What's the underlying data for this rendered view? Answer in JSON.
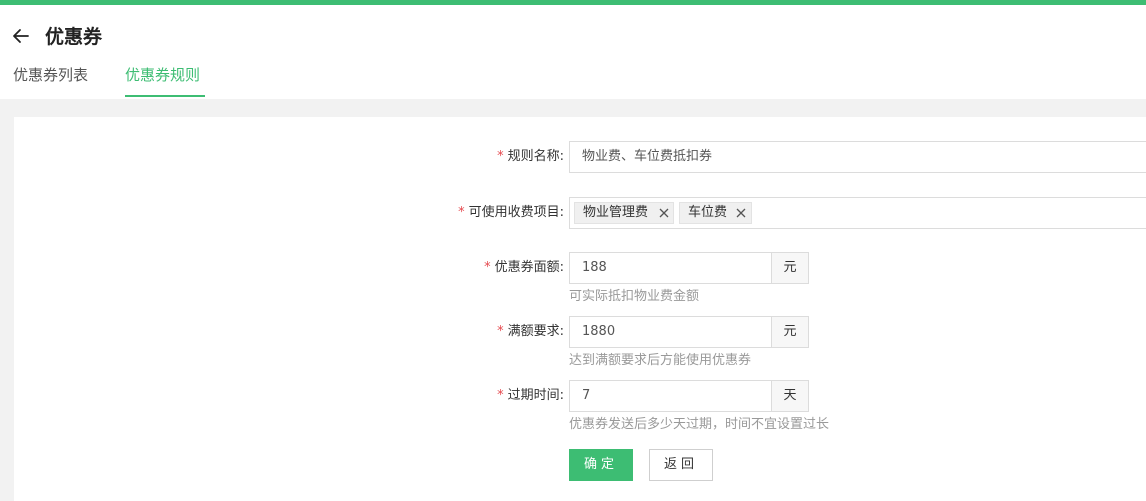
{
  "colors": {
    "brand": "#3dbd73",
    "required": "#e5484d",
    "hint": "#999999",
    "background": "#f2f2f2"
  },
  "header": {
    "title": "优惠券",
    "back_icon": "arrow-left-icon"
  },
  "tabs": [
    {
      "label": "优惠券列表",
      "active": false
    },
    {
      "label": "优惠券规则",
      "active": true
    }
  ],
  "form": {
    "required_mark": "*",
    "rule_name": {
      "label": "规则名称:",
      "value": "物业费、车位费抵扣券"
    },
    "fee_items": {
      "label": "可使用收费项目:",
      "tags": [
        "物业管理费",
        "车位费"
      ],
      "remove_icon": "close-icon"
    },
    "amount": {
      "label": "优惠券面额:",
      "value": "188",
      "unit": "元",
      "hint": "可实际抵扣物业费金额"
    },
    "threshold": {
      "label": "满额要求:",
      "value": "1880",
      "unit": "元",
      "hint": "达到满额要求后方能使用优惠券"
    },
    "expiry": {
      "label": "过期时间:",
      "value": "7",
      "unit": "天",
      "hint": "优惠券发送后多少天过期，时间不宜设置过长"
    },
    "confirm_label": "确定",
    "back_label": "返回"
  }
}
